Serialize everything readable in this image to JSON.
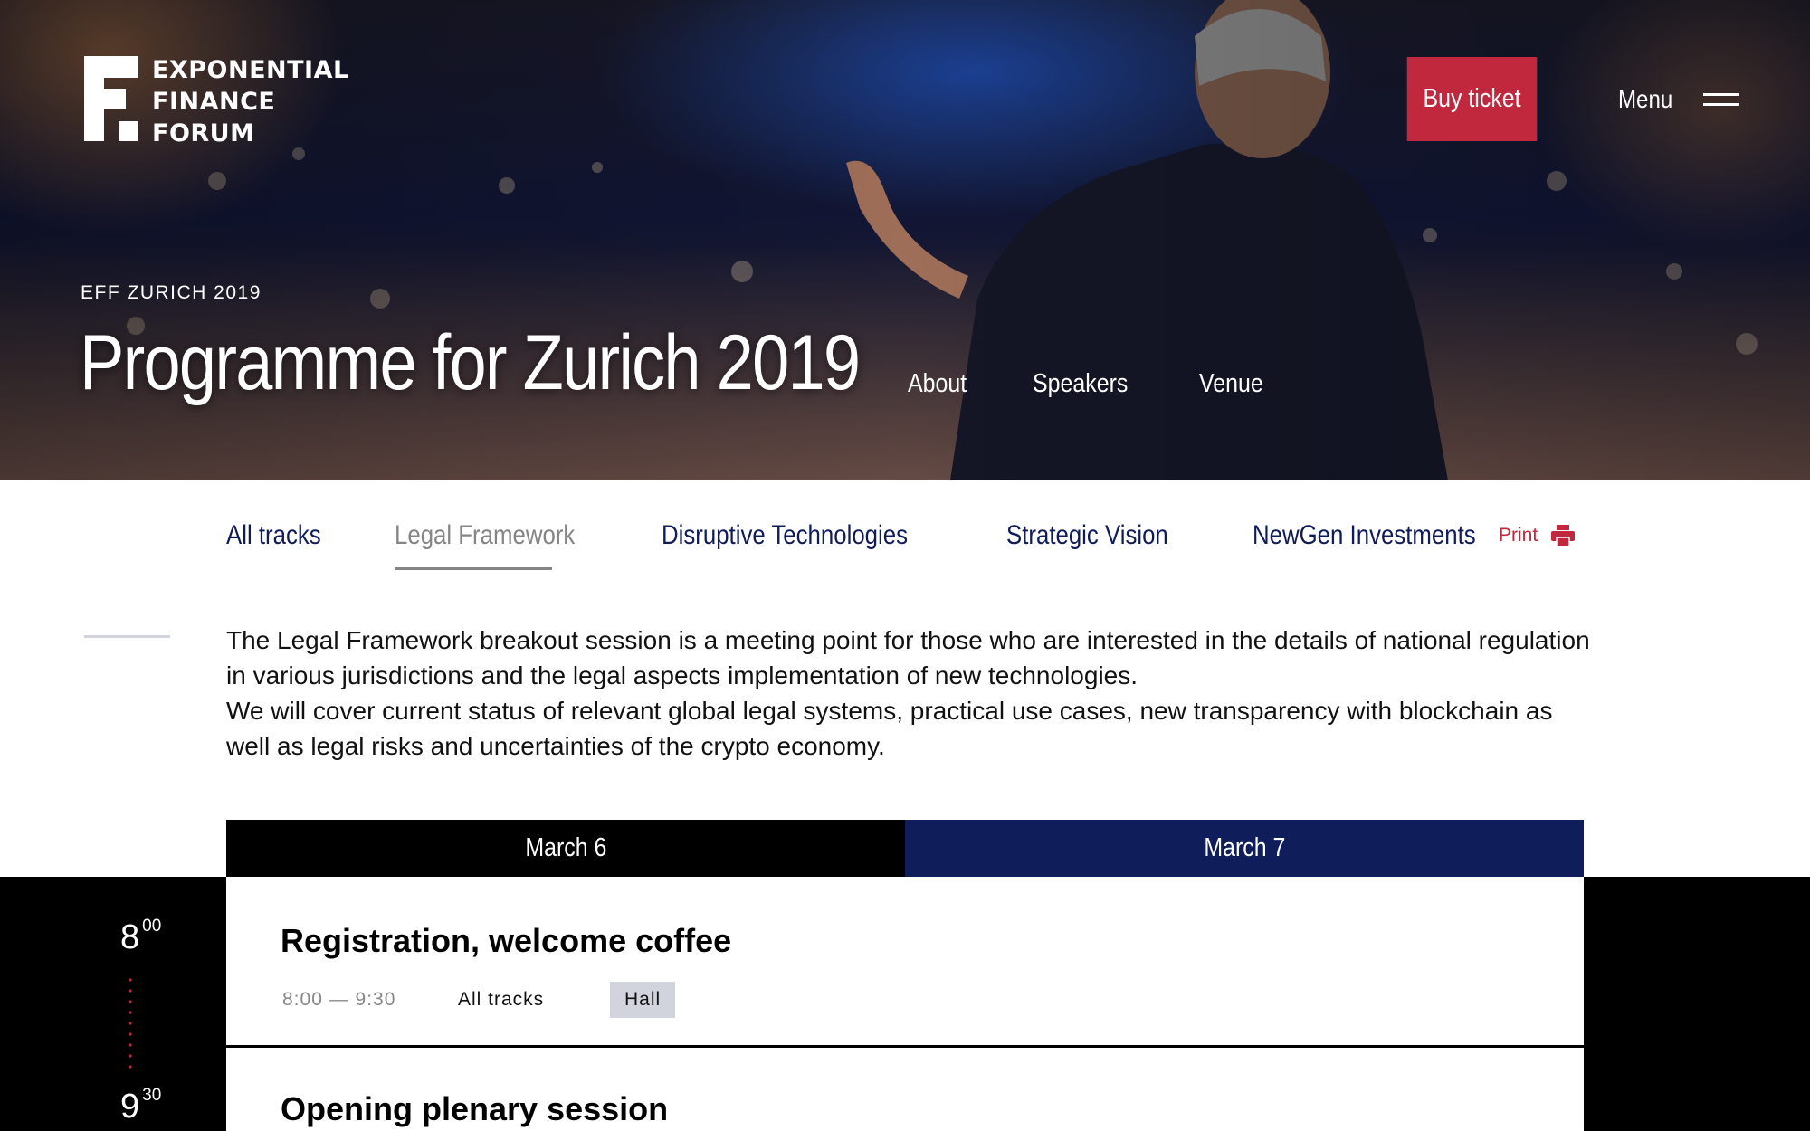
{
  "brand": {
    "logo_lines": [
      "EXPONENTIAL",
      "FINANCE",
      "FORUM"
    ]
  },
  "header": {
    "buy_ticket_label": "Buy ticket",
    "menu_label": "Menu"
  },
  "hero": {
    "eyebrow": "EFF ZURICH 2019",
    "title": "Programme for Zurich 2019",
    "nav": [
      "About",
      "Speakers",
      "Venue"
    ]
  },
  "tracks": {
    "items": [
      "All tracks",
      "Legal Framework",
      "Disruptive Technologies",
      "Strategic Vision",
      "NewGen Investments"
    ],
    "active_index": 1,
    "print_label": "Print"
  },
  "description": {
    "paragraph1": "The Legal Framework breakout session is a meeting point for those who are interested in the details of national regulation in various jurisdictions and the legal aspects implementation of new technologies.",
    "paragraph2": "We will cover  current status of relevant global legal systems, practical use cases, new transparency with blockchain as well as legal risks and uncertainties of the crypto economy."
  },
  "days": [
    "March 6",
    "March 7"
  ],
  "schedule": [
    {
      "hour": "8",
      "minutes": "00",
      "title": "Registration, welcome coffee",
      "time_range": "8:00 — 9:30",
      "track": "All tracks",
      "location": "Hall"
    },
    {
      "hour": "9",
      "minutes": "30",
      "title": "Opening plenary session"
    }
  ],
  "colors": {
    "accent_red": "#c1283d",
    "navy": "#0f1d5a",
    "muted_gray": "#858585",
    "tag_bg": "#d2d4dd"
  },
  "icons": [
    "hamburger-menu-icon",
    "printer-icon"
  ]
}
